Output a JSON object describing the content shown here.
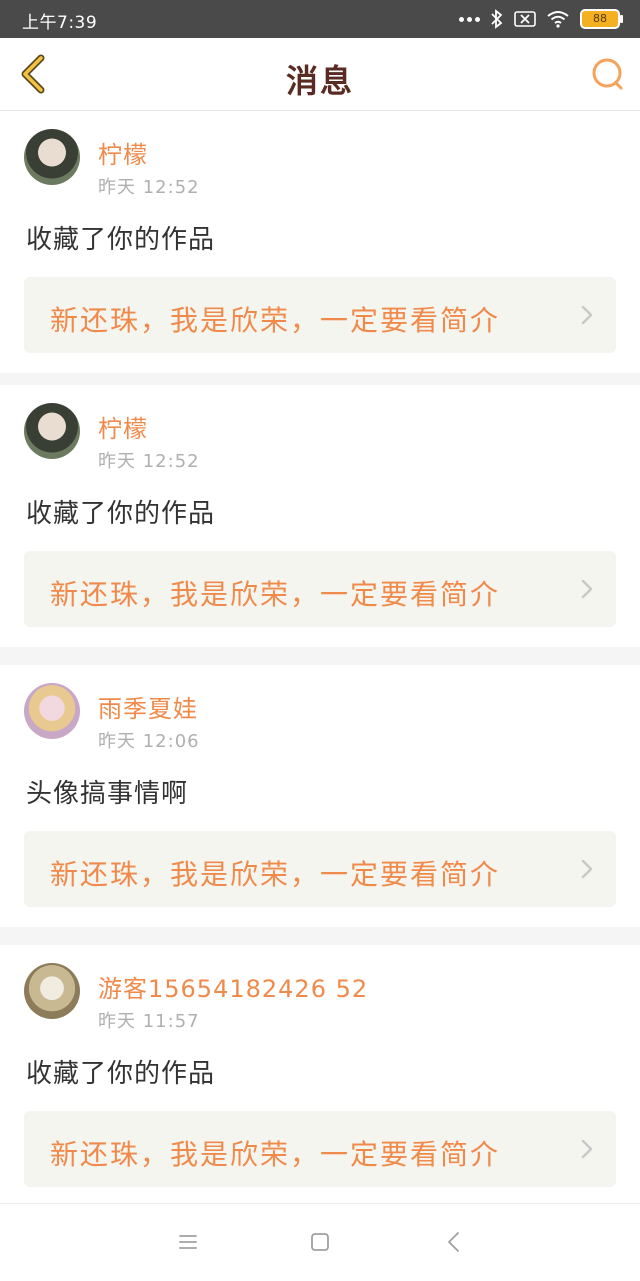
{
  "status_bar": {
    "time": "上午7:39",
    "battery": "88",
    "icons": [
      "more-dots-icon",
      "bluetooth-icon",
      "no-sim-icon",
      "wifi-icon",
      "battery-icon"
    ]
  },
  "header": {
    "title": "消息",
    "back_icon": "chevron-left-icon",
    "search_icon": "search-icon"
  },
  "colors": {
    "accent": "#f08a4b",
    "title": "#5a2b22",
    "link_bg": "#f5f5ef",
    "timestamp": "#b0b0b0",
    "back_icon": "#f5c242"
  },
  "messages": [
    {
      "username": "柠檬",
      "time": "昨天 12:52",
      "text": "收藏了你的作品",
      "work_title": "新还珠，我是欣荣，一定要看简介"
    },
    {
      "username": "柠檬",
      "time": "昨天 12:52",
      "text": "收藏了你的作品",
      "work_title": "新还珠，我是欣荣，一定要看简介"
    },
    {
      "username": "雨季夏娃",
      "time": "昨天 12:06",
      "text": "头像搞事情啊",
      "work_title": "新还珠，我是欣荣，一定要看简介"
    },
    {
      "username": "游客15654182426 52",
      "time": "昨天 11:57",
      "text": "收藏了你的作品",
      "work_title": "新还珠，我是欣荣，一定要看简介"
    }
  ],
  "nav_bar": {
    "icons": [
      "menu-icon",
      "home-square-icon",
      "back-triangle-icon"
    ]
  }
}
